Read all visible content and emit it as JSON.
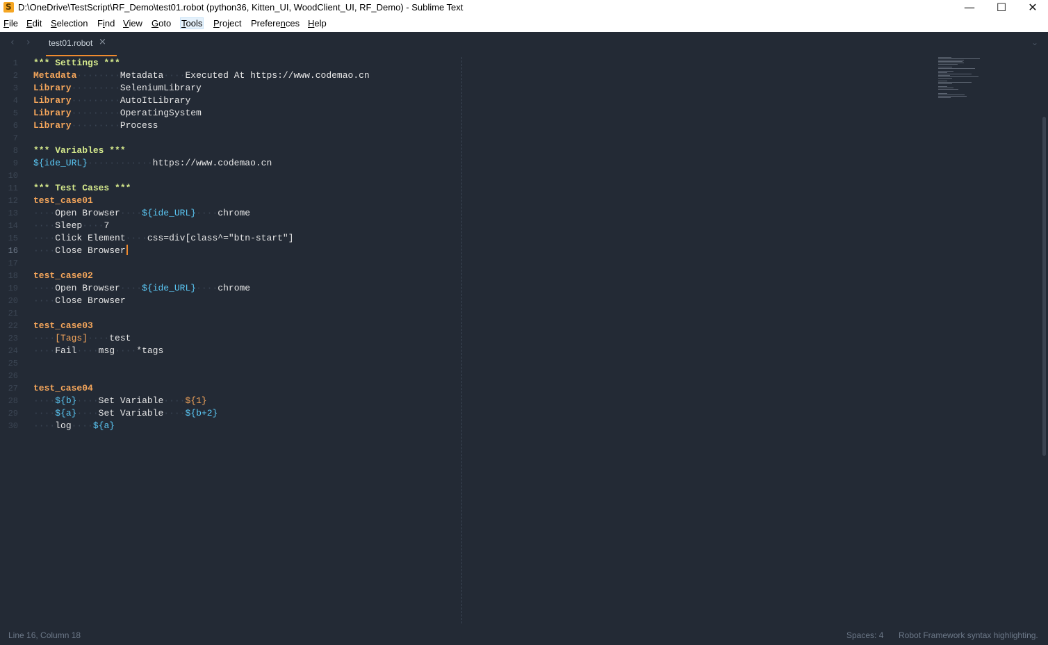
{
  "window": {
    "title": "D:\\OneDrive\\TestScript\\RF_Demo\\test01.robot (python36, Kitten_UI, WoodClient_UI, RF_Demo) - Sublime Text",
    "minimize": "—",
    "maximize": "☐",
    "close": "✕"
  },
  "menu": [
    {
      "pre": "",
      "u": "F",
      "post": "ile"
    },
    {
      "pre": "",
      "u": "E",
      "post": "dit"
    },
    {
      "pre": "",
      "u": "S",
      "post": "election"
    },
    {
      "pre": "F",
      "u": "i",
      "post": "nd"
    },
    {
      "pre": "",
      "u": "V",
      "post": "iew"
    },
    {
      "pre": "",
      "u": "G",
      "post": "oto"
    },
    {
      "pre": "",
      "u": "T",
      "post": "ools"
    },
    {
      "pre": "",
      "u": "P",
      "post": "roject"
    },
    {
      "pre": "Prefere",
      "u": "n",
      "post": "ces"
    },
    {
      "pre": "",
      "u": "H",
      "post": "elp"
    }
  ],
  "tab": {
    "label": "test01.robot",
    "close_icon": "×"
  },
  "nav": {
    "back": "‹",
    "forward": "›",
    "dropdown": "⌄"
  },
  "editor": {
    "lines": [
      [
        [
          "hdr",
          "*** Settings ***"
        ]
      ],
      [
        [
          "kw",
          "Metadata"
        ],
        [
          "sep",
          "········"
        ],
        [
          "txt",
          "Metadata"
        ],
        [
          "sep",
          "····"
        ],
        [
          "txt",
          "Executed At https://www.codemao.cn"
        ]
      ],
      [
        [
          "kw",
          "Library"
        ],
        [
          "sep",
          "·········"
        ],
        [
          "txt",
          "SeleniumLibrary"
        ]
      ],
      [
        [
          "kw",
          "Library"
        ],
        [
          "sep",
          "·········"
        ],
        [
          "txt",
          "AutoItLibrary"
        ]
      ],
      [
        [
          "kw",
          "Library"
        ],
        [
          "sep",
          "·········"
        ],
        [
          "txt",
          "OperatingSystem"
        ]
      ],
      [
        [
          "kw",
          "Library"
        ],
        [
          "sep",
          "·········"
        ],
        [
          "txt",
          "Process"
        ]
      ],
      [],
      [
        [
          "hdr",
          "*** Variables ***"
        ]
      ],
      [
        [
          "var",
          "${ide_URL}"
        ],
        [
          "sep",
          "············"
        ],
        [
          "txt",
          "https://www.codemao.cn"
        ]
      ],
      [],
      [
        [
          "hdr",
          "*** Test Cases ***"
        ]
      ],
      [
        [
          "kw",
          "test_case01"
        ]
      ],
      [
        [
          "sep",
          "····"
        ],
        [
          "txt",
          "Open Browser"
        ],
        [
          "sep",
          "····"
        ],
        [
          "var",
          "${ide_URL}"
        ],
        [
          "sep",
          "····"
        ],
        [
          "txt",
          "chrome"
        ]
      ],
      [
        [
          "sep",
          "····"
        ],
        [
          "txt",
          "Sleep"
        ],
        [
          "sep",
          "····"
        ],
        [
          "txt",
          "7"
        ]
      ],
      [
        [
          "sep",
          "····"
        ],
        [
          "txt",
          "Click Element"
        ],
        [
          "sep",
          "····"
        ],
        [
          "txt",
          "css=div[class^=\"btn-start\"]"
        ]
      ],
      [
        [
          "sep",
          "····"
        ],
        [
          "txt",
          "Close Browser"
        ]
      ],
      [],
      [
        [
          "kw",
          "test_case02"
        ]
      ],
      [
        [
          "sep",
          "····"
        ],
        [
          "txt",
          "Open Browser"
        ],
        [
          "sep",
          "····"
        ],
        [
          "var",
          "${ide_URL}"
        ],
        [
          "sep",
          "····"
        ],
        [
          "txt",
          "chrome"
        ]
      ],
      [
        [
          "sep",
          "····"
        ],
        [
          "txt",
          "Close Browser"
        ]
      ],
      [],
      [
        [
          "kw",
          "test_case03"
        ]
      ],
      [
        [
          "sep",
          "····"
        ],
        [
          "num",
          "[Tags]"
        ],
        [
          "sep",
          "····"
        ],
        [
          "txt",
          "test"
        ]
      ],
      [
        [
          "sep",
          "····"
        ],
        [
          "txt",
          "Fail"
        ],
        [
          "sep",
          "····"
        ],
        [
          "txt",
          "msg"
        ],
        [
          "sep",
          "····"
        ],
        [
          "txt",
          "*tags"
        ]
      ],
      [],
      [],
      [
        [
          "kw",
          "test_case04"
        ]
      ],
      [
        [
          "sep",
          "····"
        ],
        [
          "var",
          "${b}"
        ],
        [
          "sep",
          "····"
        ],
        [
          "txt",
          "Set Variable"
        ],
        [
          "sep",
          "····"
        ],
        [
          "num",
          "${1}"
        ]
      ],
      [
        [
          "sep",
          "····"
        ],
        [
          "var",
          "${a}"
        ],
        [
          "sep",
          "····"
        ],
        [
          "txt",
          "Set Variable"
        ],
        [
          "sep",
          "····"
        ],
        [
          "var",
          "${b+2}"
        ]
      ],
      [
        [
          "sep",
          "····"
        ],
        [
          "txt",
          "log"
        ],
        [
          "sep",
          "····"
        ],
        [
          "var",
          "${a}"
        ]
      ]
    ],
    "current_line": 16
  },
  "status": {
    "position": "Line 16, Column 18",
    "spaces": "Spaces: 4",
    "syntax": "Robot Framework syntax highlighting."
  },
  "colors": {
    "background": "#232a35",
    "header": "#d5e98c",
    "keyword": "#f5a65b",
    "variable": "#5bc8f5",
    "caret": "#f08b2e"
  }
}
